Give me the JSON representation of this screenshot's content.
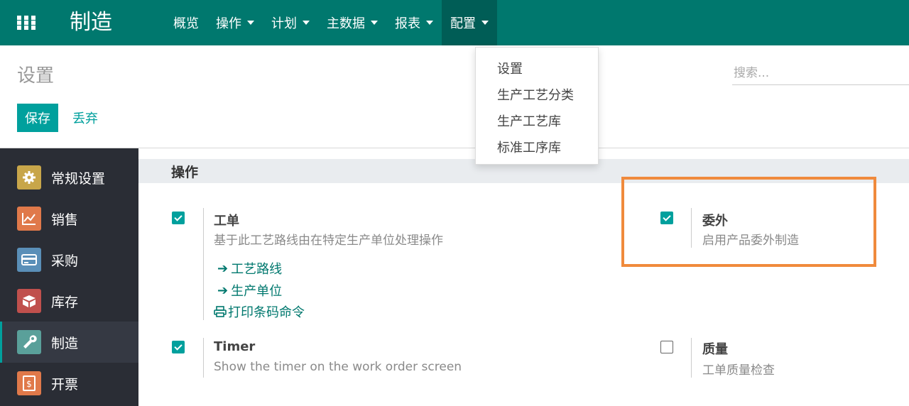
{
  "app": {
    "name": "制造"
  },
  "nav": {
    "items": [
      {
        "label": "概览",
        "has_caret": false
      },
      {
        "label": "操作",
        "has_caret": true
      },
      {
        "label": "计划",
        "has_caret": true
      },
      {
        "label": "主数据",
        "has_caret": true
      },
      {
        "label": "报表",
        "has_caret": true
      },
      {
        "label": "配置",
        "has_caret": true,
        "active": true
      }
    ]
  },
  "dropdown": {
    "items": [
      "设置",
      "生产工艺分类",
      "生产工艺库",
      "标准工序库"
    ]
  },
  "control_panel": {
    "title": "设置",
    "search_placeholder": "搜索...",
    "save_label": "保存",
    "discard_label": "丢弃"
  },
  "sidebar": {
    "items": [
      {
        "label": "常规设置",
        "icon": "gear-icon",
        "color": "#c8a64a"
      },
      {
        "label": "销售",
        "icon": "chart-icon",
        "color": "#e0794a"
      },
      {
        "label": "采购",
        "icon": "card-icon",
        "color": "#5a8fb8"
      },
      {
        "label": "库存",
        "icon": "box-icon",
        "color": "#c0504d"
      },
      {
        "label": "制造",
        "icon": "wrench-icon",
        "color": "#5aa09a",
        "active": true
      },
      {
        "label": "开票",
        "icon": "invoice-icon",
        "color": "#e0794a"
      }
    ]
  },
  "section": {
    "title": "操作"
  },
  "settings": {
    "workorder": {
      "title": "工单",
      "desc": "基于此工艺路线由在特定生产单位处理操作",
      "checked": true,
      "links": [
        "工艺路线",
        "生产单位",
        "打印条码命令"
      ]
    },
    "subcontract": {
      "title": "委外",
      "desc": "启用产品委外制造",
      "checked": true
    },
    "timer": {
      "title": "Timer",
      "desc": "Show the timer on the work order screen",
      "checked": true
    },
    "quality": {
      "title": "质量",
      "desc": "工单质量检查",
      "checked": false
    }
  },
  "colors": {
    "nav": "#00786e",
    "accent": "#00a09d",
    "highlight": "#f08a3c"
  }
}
